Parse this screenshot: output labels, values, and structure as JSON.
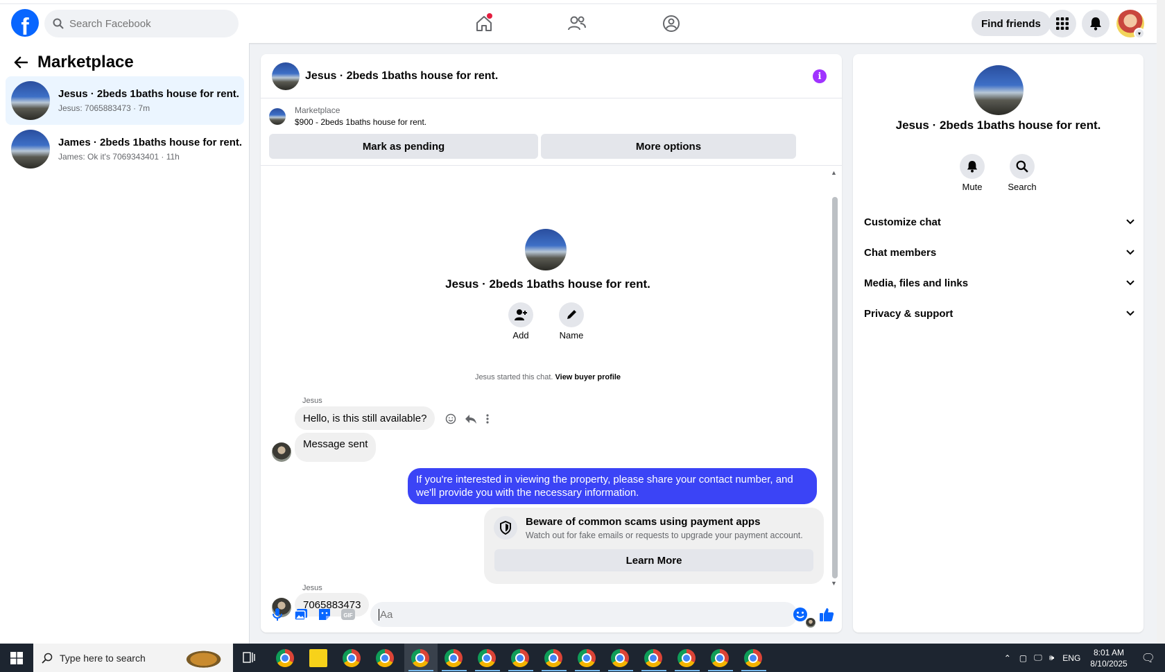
{
  "topbar": {
    "logo": "f",
    "search_placeholder": "Search Facebook",
    "find_friends": "Find friends"
  },
  "left": {
    "title": "Marketplace",
    "conversations": [
      {
        "title": "Jesus · 2beds 1baths house for rent.",
        "preview": "Jesus: 7065883473 · 7m",
        "active": true
      },
      {
        "title": "James · 2beds 1baths house for rent.",
        "preview": "James: Ok it's 7069343401 · 11h",
        "active": false
      }
    ]
  },
  "chat": {
    "title": "Jesus · 2beds 1baths house for rent.",
    "marketplace_label": "Marketplace",
    "listing": "$900 - 2beds 1baths house for rent.",
    "mark_pending": "Mark as pending",
    "more_options": "More options",
    "center_name": "Jesus · 2beds 1baths house for rent.",
    "add_label": "Add",
    "name_label": "Name",
    "started_text": "Jesus started this chat.",
    "view_buyer": "View buyer profile",
    "messages": {
      "sender1": "Jesus",
      "msg1": "Hello, is this still available?",
      "msg2": "Message sent",
      "outgoing": "If you're interested in viewing the property, please share your contact number, and we'll provide you with the necessary information.",
      "sender2": "Jesus",
      "msg3": "7065883473"
    },
    "scam": {
      "title": "Beware of common scams using payment apps",
      "subtitle": "Watch out for fake emails or requests to upgrade your payment account.",
      "button": "Learn More"
    },
    "composer_placeholder": "Aa"
  },
  "right": {
    "name": "Jesus · 2beds 1baths house for rent.",
    "mute": "Mute",
    "search": "Search",
    "sections": [
      "Customize chat",
      "Chat members",
      "Media, files and links",
      "Privacy & support"
    ]
  },
  "taskbar": {
    "search_placeholder": "Type here to search",
    "lang": "ENG",
    "time": "8:01 AM",
    "date": "8/10/2025"
  },
  "colors": {
    "accent": "#0866ff",
    "outgoing_bubble": "#3b44f6",
    "info": "#a033ff",
    "notification_dot": "#e41e3f"
  }
}
